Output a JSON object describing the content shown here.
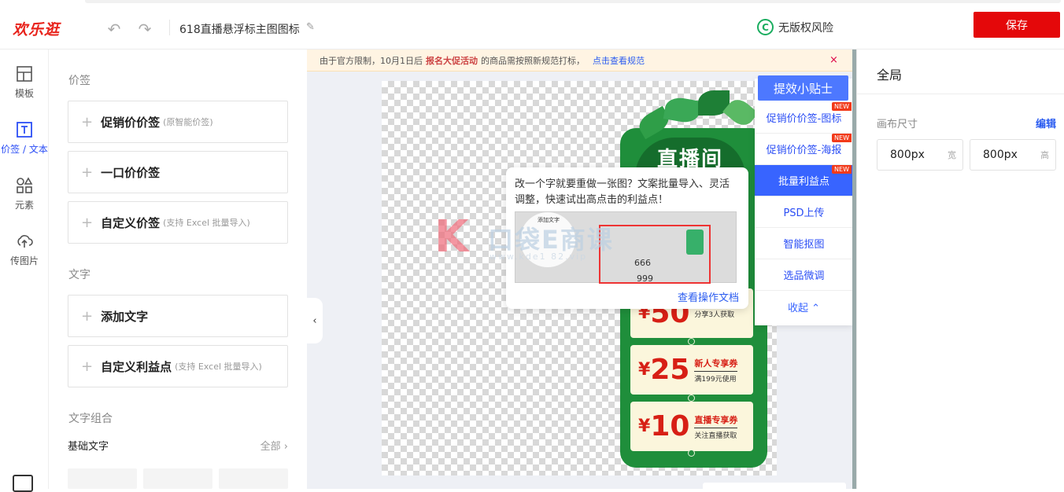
{
  "header": {
    "logo": "欢乐逛",
    "doc_title": "618直播悬浮标主图图标",
    "copyright_badge": "C",
    "copyright": "无版权风险",
    "save_label": "保存"
  },
  "nav": {
    "items": [
      {
        "label": "模板",
        "icon": "layout-icon"
      },
      {
        "label": "价签 / 文本",
        "icon": "text-icon"
      },
      {
        "label": "元素",
        "icon": "shapes-icon"
      },
      {
        "label": "传图片",
        "icon": "upload-cloud-icon"
      }
    ]
  },
  "panel": {
    "price_section": "价签",
    "price_cards": [
      {
        "label": "促销价价签",
        "sub": "(原智能价签)"
      },
      {
        "label": "一口价价签",
        "sub": ""
      },
      {
        "label": "自定义价签",
        "sub": "(支持 Excel 批量导入)"
      }
    ],
    "text_section": "文字",
    "text_cards": [
      {
        "label": "添加文字",
        "sub": ""
      },
      {
        "label": "自定义利益点",
        "sub": "(支持 Excel 批量导入)"
      }
    ],
    "group_section": "文字组合",
    "group_row_label": "基础文字",
    "group_row_all": "全部"
  },
  "notice": {
    "prefix": "由于官方限制，10月1日后",
    "highlight": "报名大促活动",
    "suffix": "的商品需按照新规范打标，",
    "link": "点击查看规范",
    "close": "×"
  },
  "poster": {
    "title": "直播间",
    "coupons": [
      {
        "yen": "¥",
        "amount": "50",
        "t1": "",
        "t2": "分享3人获取"
      },
      {
        "yen": "¥",
        "amount": "25",
        "t1": "新人专享券",
        "t2": "满199元使用"
      },
      {
        "yen": "¥",
        "amount": "10",
        "t1": "直播专享券",
        "t2": "关注直播获取"
      }
    ]
  },
  "tip": {
    "desc": "改一个字就要重做一张图？文案批量导入、灵活调整，快速试出高点击的利益点！",
    "shot_title": "添加文字",
    "shot_n1": "666",
    "shot_n2": "999",
    "doc_link": "查看操作文档"
  },
  "watermark": {
    "k": "K",
    "brand": "口袋E商课",
    "url": "www.kde1 82.vip"
  },
  "tools": {
    "head": "提效小贴士",
    "items": [
      {
        "label": "促销价价签-图标",
        "new": "NEW"
      },
      {
        "label": "促销价价签-海报",
        "new": "NEW"
      },
      {
        "label": "批量利益点",
        "new": "NEW"
      },
      {
        "label": "PSD上传",
        "new": ""
      },
      {
        "label": "智能抠图",
        "new": ""
      },
      {
        "label": "选品微调",
        "new": ""
      }
    ],
    "collapse": "收起 ⌃"
  },
  "right": {
    "title": "全局",
    "canvas_label": "画布尺寸",
    "edit": "编辑",
    "width_value": "800px",
    "width_unit": "宽",
    "height_value": "800px",
    "height_unit": "高"
  },
  "colors": {
    "brand_red": "#e4080a",
    "accent_blue": "#2b4ef5",
    "poster_green": "#1f8e3b"
  }
}
